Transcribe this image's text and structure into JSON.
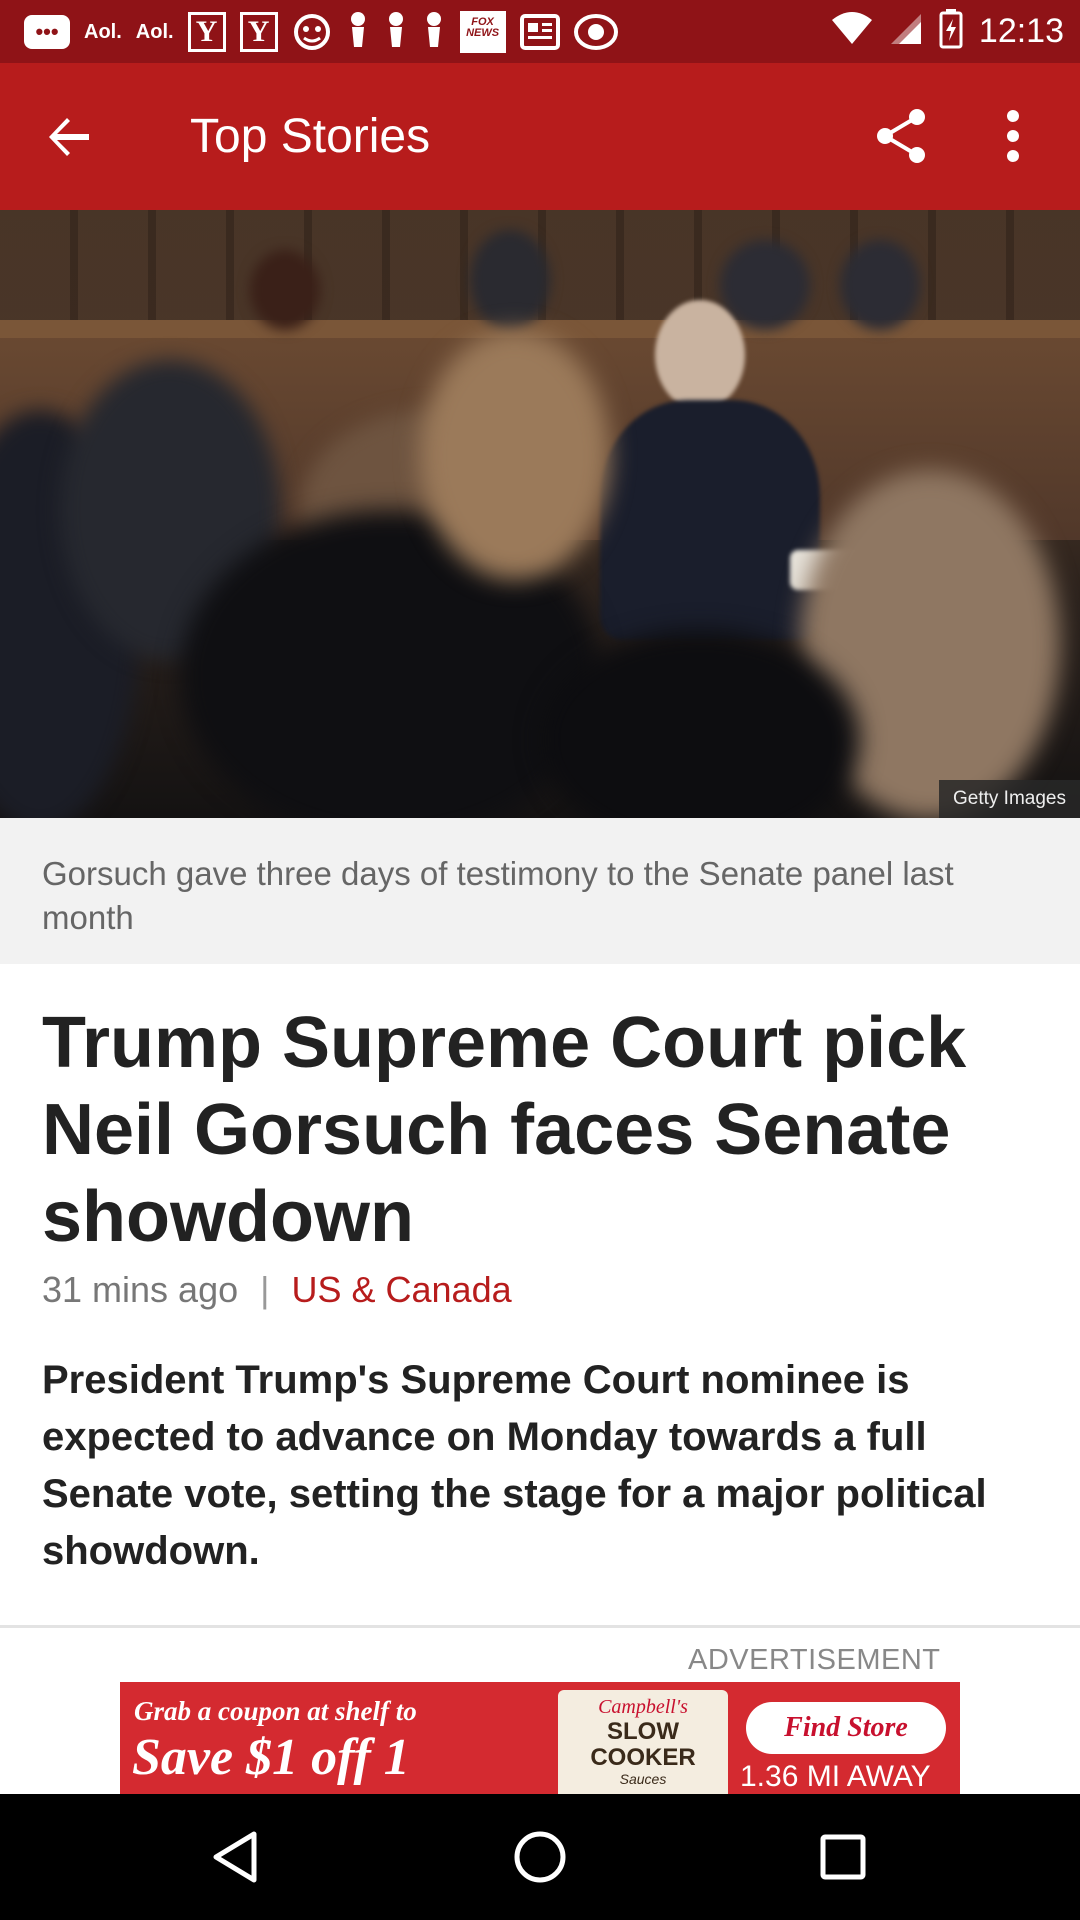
{
  "status_bar": {
    "time": "12:13",
    "notification_icons": [
      {
        "name": "messages-icon"
      },
      {
        "name": "aol-icon",
        "text": "Aol."
      },
      {
        "name": "aol-icon",
        "text": "Aol."
      },
      {
        "name": "yahoo-icon",
        "text": "Y"
      },
      {
        "name": "yahoo-icon",
        "text": "Y"
      },
      {
        "name": "app-icon"
      },
      {
        "name": "pin-icon"
      },
      {
        "name": "pin-icon"
      },
      {
        "name": "pin-icon"
      },
      {
        "name": "fox-news-icon",
        "text": "FOX NEWS"
      },
      {
        "name": "news-icon"
      },
      {
        "name": "cbs-icon"
      }
    ],
    "system_icons": [
      "wifi-icon",
      "signal-icon",
      "battery-charging-icon"
    ]
  },
  "app_bar": {
    "title": "Top Stories",
    "back_icon": "arrow-back-icon",
    "share_icon": "share-icon",
    "more_icon": "more-vert-icon",
    "background": "#b71c1c"
  },
  "hero": {
    "credit": "Getty Images"
  },
  "caption": "Gorsuch gave three days of testimony to the Senate panel last month",
  "article": {
    "headline": "Trump Supreme Court pick Neil Gorsuch faces Senate showdown",
    "time_ago": "31 mins ago",
    "separator": "|",
    "category": "US & Canada",
    "summary": "President Trump's Supreme Court nominee is expected to advance on Monday towards a full Senate vote, setting the stage for a major political showdown."
  },
  "advertisement": {
    "label": "ADVERTISEMENT",
    "line1": "Grab a coupon at shelf to",
    "line2": "Save $1 off 1",
    "brand": "Campbell's",
    "product_name": "SLOW COOKER",
    "product_sub": "Sauces",
    "cta": "Find Store",
    "distance": "1.36 MI AWAY"
  },
  "nav_bar": {
    "back": "nav-back-icon",
    "home": "nav-home-icon",
    "recents": "nav-recents-icon"
  }
}
